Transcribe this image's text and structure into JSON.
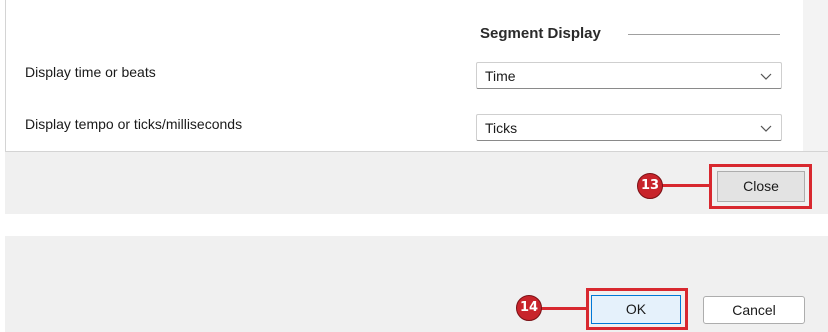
{
  "settings": {
    "section_heading": "Segment Display",
    "rows": [
      {
        "label": "Display time or beats",
        "value": "Time"
      },
      {
        "label": "Display tempo or ticks/milliseconds",
        "value": "Ticks"
      }
    ]
  },
  "dialog_top": {
    "close_label": "Close",
    "callout_number": "13"
  },
  "dialog_bottom": {
    "ok_label": "OK",
    "cancel_label": "Cancel",
    "callout_number": "14"
  },
  "colors": {
    "highlight": "#d8282f",
    "callout_fill": "#c8242b",
    "panel_bg": "#f0f0f0",
    "default_button_border": "#0078d7"
  },
  "icons": [
    "chevron-down-icon"
  ]
}
